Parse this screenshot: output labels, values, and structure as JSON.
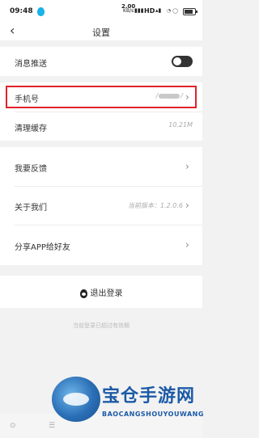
{
  "status_bar": {
    "time": "09:48",
    "speed_value": "2.00",
    "speed_unit": "KB/s",
    "signal_label": "HD",
    "battery_percent": 80
  },
  "header": {
    "back_icon": "chevron-left-icon",
    "title": "设置"
  },
  "settings": {
    "push": {
      "label": "消息推送",
      "enabled": true
    },
    "phone": {
      "label": "手机号",
      "value_prefix": "/",
      "value_suffix": "/"
    },
    "cache": {
      "label": "清理缓存",
      "value": "10.21M"
    },
    "feedback": {
      "label": "我要反馈"
    },
    "about": {
      "label": "关于我们",
      "value": "当前版本：1.2.0.6"
    },
    "share": {
      "label": "分享APP给好友"
    }
  },
  "logout": {
    "label": "退出登录"
  },
  "footer_note": "当前登录已超过有效期",
  "watermark": {
    "cn": "宝仓手游网",
    "en": "BAOCANGSHOUYOUWANG"
  }
}
